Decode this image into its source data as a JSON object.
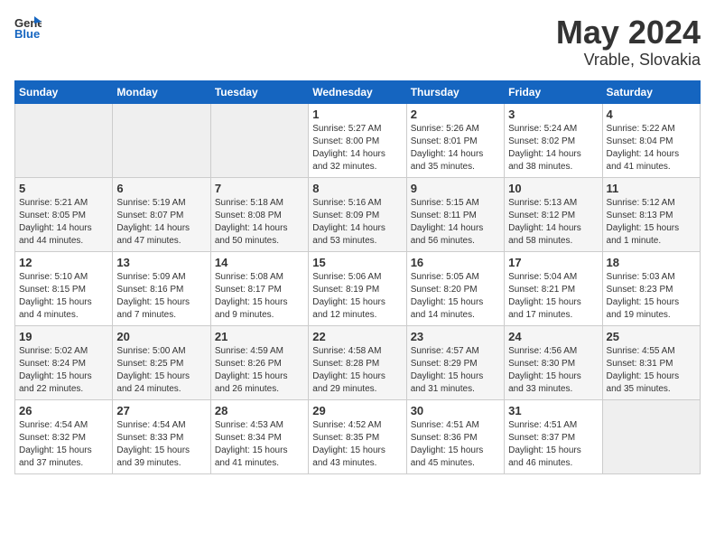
{
  "header": {
    "logo_general": "General",
    "logo_blue": "Blue",
    "title": "May 2024",
    "location": "Vrable, Slovakia"
  },
  "calendar": {
    "days_of_week": [
      "Sunday",
      "Monday",
      "Tuesday",
      "Wednesday",
      "Thursday",
      "Friday",
      "Saturday"
    ],
    "weeks": [
      [
        {
          "day": "",
          "info": ""
        },
        {
          "day": "",
          "info": ""
        },
        {
          "day": "",
          "info": ""
        },
        {
          "day": "1",
          "info": "Sunrise: 5:27 AM\nSunset: 8:00 PM\nDaylight: 14 hours\nand 32 minutes."
        },
        {
          "day": "2",
          "info": "Sunrise: 5:26 AM\nSunset: 8:01 PM\nDaylight: 14 hours\nand 35 minutes."
        },
        {
          "day": "3",
          "info": "Sunrise: 5:24 AM\nSunset: 8:02 PM\nDaylight: 14 hours\nand 38 minutes."
        },
        {
          "day": "4",
          "info": "Sunrise: 5:22 AM\nSunset: 8:04 PM\nDaylight: 14 hours\nand 41 minutes."
        }
      ],
      [
        {
          "day": "5",
          "info": "Sunrise: 5:21 AM\nSunset: 8:05 PM\nDaylight: 14 hours\nand 44 minutes."
        },
        {
          "day": "6",
          "info": "Sunrise: 5:19 AM\nSunset: 8:07 PM\nDaylight: 14 hours\nand 47 minutes."
        },
        {
          "day": "7",
          "info": "Sunrise: 5:18 AM\nSunset: 8:08 PM\nDaylight: 14 hours\nand 50 minutes."
        },
        {
          "day": "8",
          "info": "Sunrise: 5:16 AM\nSunset: 8:09 PM\nDaylight: 14 hours\nand 53 minutes."
        },
        {
          "day": "9",
          "info": "Sunrise: 5:15 AM\nSunset: 8:11 PM\nDaylight: 14 hours\nand 56 minutes."
        },
        {
          "day": "10",
          "info": "Sunrise: 5:13 AM\nSunset: 8:12 PM\nDaylight: 14 hours\nand 58 minutes."
        },
        {
          "day": "11",
          "info": "Sunrise: 5:12 AM\nSunset: 8:13 PM\nDaylight: 15 hours\nand 1 minute."
        }
      ],
      [
        {
          "day": "12",
          "info": "Sunrise: 5:10 AM\nSunset: 8:15 PM\nDaylight: 15 hours\nand 4 minutes."
        },
        {
          "day": "13",
          "info": "Sunrise: 5:09 AM\nSunset: 8:16 PM\nDaylight: 15 hours\nand 7 minutes."
        },
        {
          "day": "14",
          "info": "Sunrise: 5:08 AM\nSunset: 8:17 PM\nDaylight: 15 hours\nand 9 minutes."
        },
        {
          "day": "15",
          "info": "Sunrise: 5:06 AM\nSunset: 8:19 PM\nDaylight: 15 hours\nand 12 minutes."
        },
        {
          "day": "16",
          "info": "Sunrise: 5:05 AM\nSunset: 8:20 PM\nDaylight: 15 hours\nand 14 minutes."
        },
        {
          "day": "17",
          "info": "Sunrise: 5:04 AM\nSunset: 8:21 PM\nDaylight: 15 hours\nand 17 minutes."
        },
        {
          "day": "18",
          "info": "Sunrise: 5:03 AM\nSunset: 8:23 PM\nDaylight: 15 hours\nand 19 minutes."
        }
      ],
      [
        {
          "day": "19",
          "info": "Sunrise: 5:02 AM\nSunset: 8:24 PM\nDaylight: 15 hours\nand 22 minutes."
        },
        {
          "day": "20",
          "info": "Sunrise: 5:00 AM\nSunset: 8:25 PM\nDaylight: 15 hours\nand 24 minutes."
        },
        {
          "day": "21",
          "info": "Sunrise: 4:59 AM\nSunset: 8:26 PM\nDaylight: 15 hours\nand 26 minutes."
        },
        {
          "day": "22",
          "info": "Sunrise: 4:58 AM\nSunset: 8:28 PM\nDaylight: 15 hours\nand 29 minutes."
        },
        {
          "day": "23",
          "info": "Sunrise: 4:57 AM\nSunset: 8:29 PM\nDaylight: 15 hours\nand 31 minutes."
        },
        {
          "day": "24",
          "info": "Sunrise: 4:56 AM\nSunset: 8:30 PM\nDaylight: 15 hours\nand 33 minutes."
        },
        {
          "day": "25",
          "info": "Sunrise: 4:55 AM\nSunset: 8:31 PM\nDaylight: 15 hours\nand 35 minutes."
        }
      ],
      [
        {
          "day": "26",
          "info": "Sunrise: 4:54 AM\nSunset: 8:32 PM\nDaylight: 15 hours\nand 37 minutes."
        },
        {
          "day": "27",
          "info": "Sunrise: 4:54 AM\nSunset: 8:33 PM\nDaylight: 15 hours\nand 39 minutes."
        },
        {
          "day": "28",
          "info": "Sunrise: 4:53 AM\nSunset: 8:34 PM\nDaylight: 15 hours\nand 41 minutes."
        },
        {
          "day": "29",
          "info": "Sunrise: 4:52 AM\nSunset: 8:35 PM\nDaylight: 15 hours\nand 43 minutes."
        },
        {
          "day": "30",
          "info": "Sunrise: 4:51 AM\nSunset: 8:36 PM\nDaylight: 15 hours\nand 45 minutes."
        },
        {
          "day": "31",
          "info": "Sunrise: 4:51 AM\nSunset: 8:37 PM\nDaylight: 15 hours\nand 46 minutes."
        },
        {
          "day": "",
          "info": ""
        }
      ]
    ]
  }
}
